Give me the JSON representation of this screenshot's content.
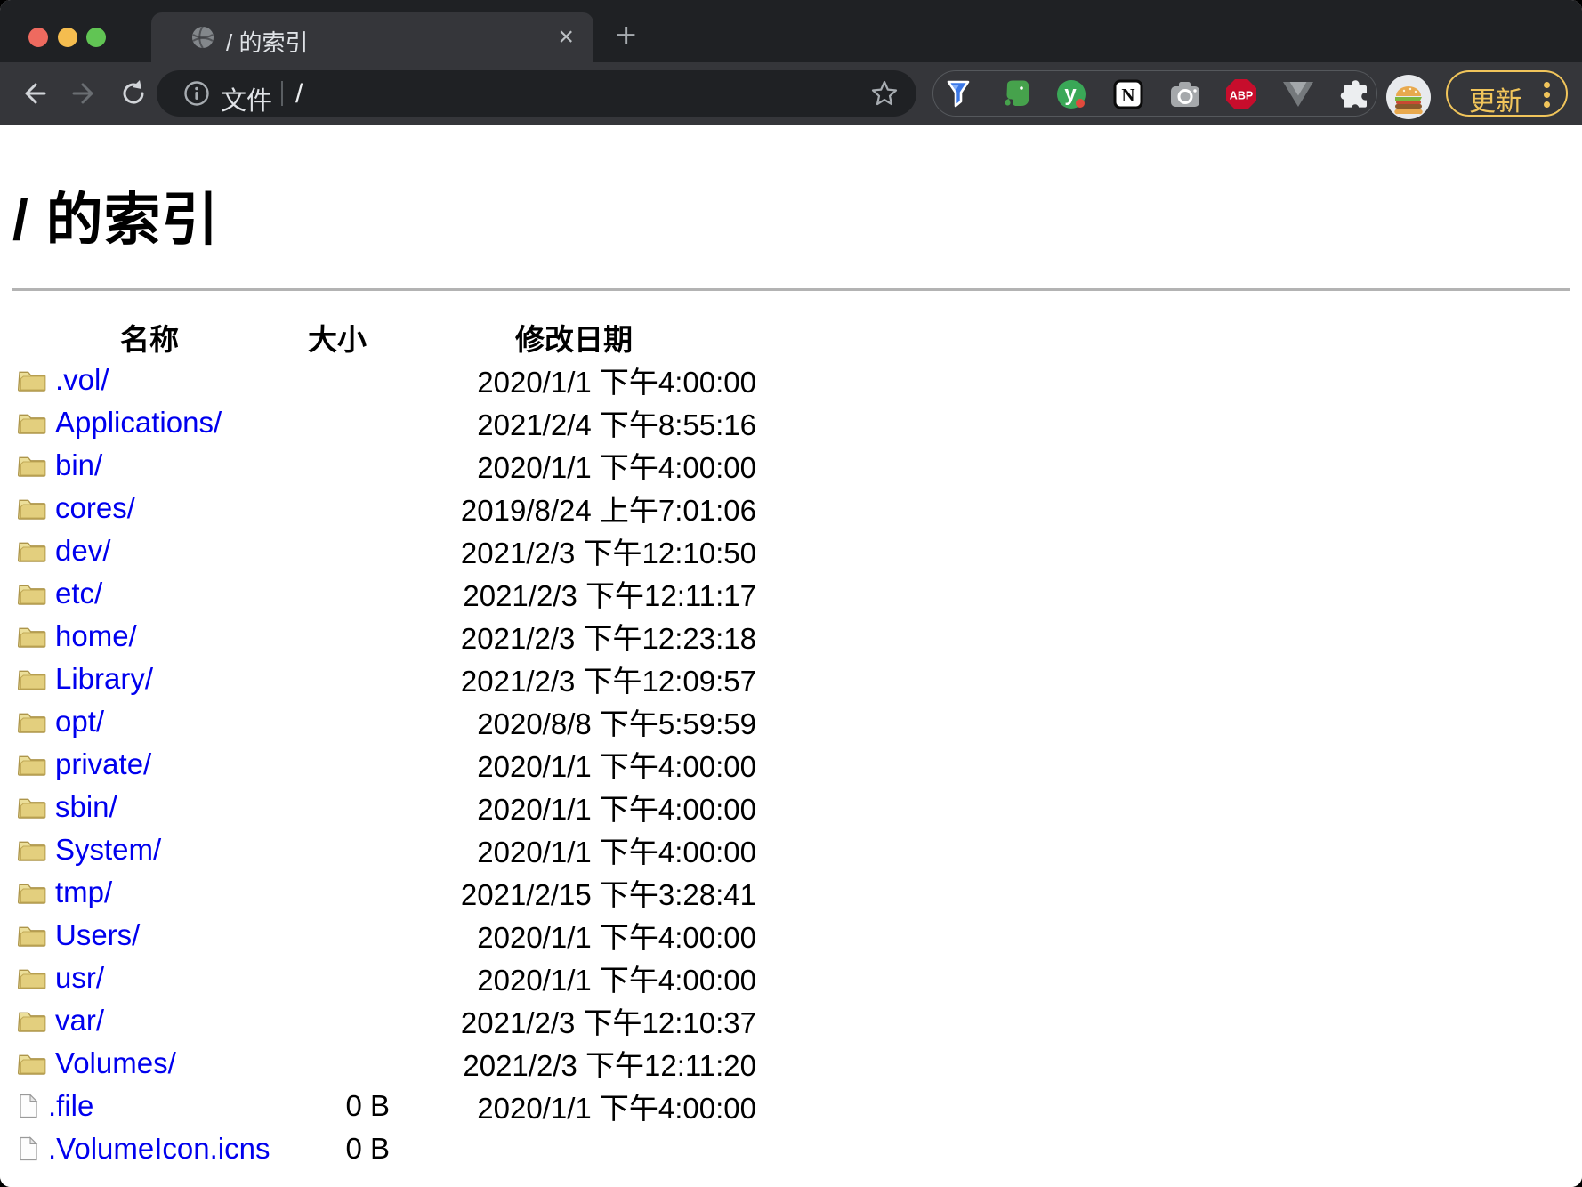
{
  "window": {
    "tab": {
      "title": "/ 的索引",
      "close_glyph": "×",
      "new_tab_glyph": "+"
    },
    "toolbar": {
      "omnibox": {
        "chip_label": "文件",
        "path": "/"
      },
      "extensions": {
        "abp_label": "ABP",
        "y_badge_label": "y",
        "notion_label": "N"
      },
      "update_button": {
        "label": "更新"
      }
    }
  },
  "colors": {
    "link_blue": "#0000ee",
    "update_gold": "#f1c55b",
    "toolbar_bg": "#35363a",
    "tabstrip_bg": "#1f2124",
    "folder_yellow": "#ecdf9a",
    "abp_red": "#c70d2c"
  },
  "page": {
    "title": "/ 的索引",
    "headers": {
      "name": "名称",
      "size": "大小",
      "date": "修改日期"
    },
    "rows": [
      {
        "type": "folder",
        "name": ".vol/",
        "size": "",
        "date": "2020/1/1 下午4:00:00"
      },
      {
        "type": "folder",
        "name": "Applications/",
        "size": "",
        "date": "2021/2/4 下午8:55:16"
      },
      {
        "type": "folder",
        "name": "bin/",
        "size": "",
        "date": "2020/1/1 下午4:00:00"
      },
      {
        "type": "folder",
        "name": "cores/",
        "size": "",
        "date": "2019/8/24 上午7:01:06"
      },
      {
        "type": "folder",
        "name": "dev/",
        "size": "",
        "date": "2021/2/3 下午12:10:50"
      },
      {
        "type": "folder",
        "name": "etc/",
        "size": "",
        "date": "2021/2/3 下午12:11:17"
      },
      {
        "type": "folder",
        "name": "home/",
        "size": "",
        "date": "2021/2/3 下午12:23:18"
      },
      {
        "type": "folder",
        "name": "Library/",
        "size": "",
        "date": "2021/2/3 下午12:09:57"
      },
      {
        "type": "folder",
        "name": "opt/",
        "size": "",
        "date": "2020/8/8 下午5:59:59"
      },
      {
        "type": "folder",
        "name": "private/",
        "size": "",
        "date": "2020/1/1 下午4:00:00"
      },
      {
        "type": "folder",
        "name": "sbin/",
        "size": "",
        "date": "2020/1/1 下午4:00:00"
      },
      {
        "type": "folder",
        "name": "System/",
        "size": "",
        "date": "2020/1/1 下午4:00:00"
      },
      {
        "type": "folder",
        "name": "tmp/",
        "size": "",
        "date": "2021/2/15 下午3:28:41"
      },
      {
        "type": "folder",
        "name": "Users/",
        "size": "",
        "date": "2020/1/1 下午4:00:00"
      },
      {
        "type": "folder",
        "name": "usr/",
        "size": "",
        "date": "2020/1/1 下午4:00:00"
      },
      {
        "type": "folder",
        "name": "var/",
        "size": "",
        "date": "2021/2/3 下午12:10:37"
      },
      {
        "type": "folder",
        "name": "Volumes/",
        "size": "",
        "date": "2021/2/3 下午12:11:20"
      },
      {
        "type": "file",
        "name": ".file",
        "size": "0 B",
        "date": "2020/1/1 下午4:00:00"
      },
      {
        "type": "file",
        "name": ".VolumeIcon.icns",
        "size": "0 B",
        "date": ""
      }
    ]
  }
}
